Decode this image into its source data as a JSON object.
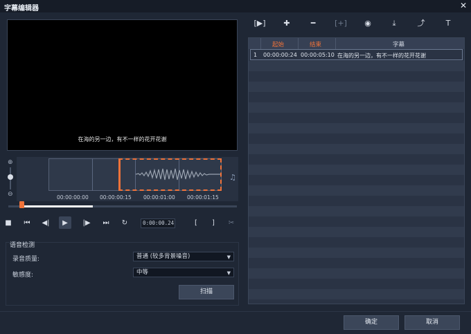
{
  "window": {
    "title": "字幕编辑器",
    "close_glyph": "✕"
  },
  "preview": {
    "subtitle_text": "在海的另一边，有不一样的花开花谢"
  },
  "timeline": {
    "labels": [
      "00:00:00:00",
      "00:00:00:15",
      "00:00:01:00",
      "00:00:01:15"
    ],
    "scrubber_progress": 0.37
  },
  "transport": {
    "icons": [
      "stop-icon",
      "go-start-icon",
      "step-back-icon",
      "play-icon",
      "step-forward-icon",
      "go-end-icon",
      "repeat-icon"
    ],
    "timecode": "0:00:00.24",
    "mark_in": "[",
    "mark_out": "]"
  },
  "voice_detection": {
    "title": "语音检测",
    "quality_label": "录音质量:",
    "quality_value": "普通 (较多背景噪音)",
    "sensitivity_label": "敏感度:",
    "sensitivity_value": "中等",
    "scan_label": "扫描"
  },
  "toolbar": {
    "icons": [
      "play-subtitle-icon",
      "add-icon",
      "remove-icon",
      "insert-icon",
      "preview-icon",
      "import-icon",
      "export-icon",
      "text-options-icon"
    ]
  },
  "table": {
    "headers": {
      "start": "起始",
      "end": "结束",
      "subtitle": "字幕"
    },
    "header_accent": "#f0733a",
    "rows": [
      {
        "index": "1",
        "start": "00:00:00:24",
        "end": "00:00:05:10",
        "text": "在海的另一边，有不一样的花开花谢"
      }
    ]
  },
  "footer": {
    "ok": "确定",
    "cancel": "取消"
  }
}
